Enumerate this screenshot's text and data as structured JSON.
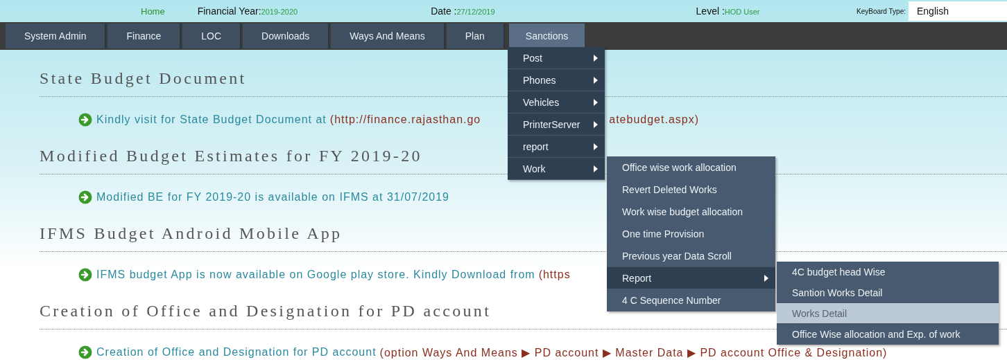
{
  "header": {
    "home": "Home",
    "financial_year_label": "Financial Year:",
    "financial_year": "2019-2020",
    "date_label": "Date :",
    "date": "27/12/2019",
    "level_label": "Level :",
    "level": "HOD User",
    "keyboard_label": "KeyBoard Type:",
    "keyboard_value": "English"
  },
  "nav": [
    {
      "label": "System Admin",
      "selected": false
    },
    {
      "label": "Finance",
      "selected": false
    },
    {
      "label": "LOC",
      "selected": false
    },
    {
      "label": "Downloads",
      "selected": false
    },
    {
      "label": "Ways And Means",
      "selected": false
    },
    {
      "label": "Plan",
      "selected": false
    },
    {
      "label": "Sanctions",
      "selected": true
    }
  ],
  "menus": [
    {
      "items": [
        {
          "label": "Post",
          "has_submenu": true
        },
        {
          "label": "Phones",
          "has_submenu": true
        },
        {
          "label": "Vehicles",
          "has_submenu": true
        },
        {
          "label": "PrinterServer",
          "has_submenu": true
        },
        {
          "label": "report",
          "has_submenu": true
        },
        {
          "label": "Work",
          "has_submenu": true
        }
      ]
    },
    {
      "items": [
        {
          "label": "Office wise work allocation",
          "has_submenu": false,
          "selected": false
        },
        {
          "label": "Revert Deleted Works",
          "has_submenu": false,
          "selected": false
        },
        {
          "label": "Work wise budget allocation",
          "has_submenu": false,
          "selected": false
        },
        {
          "label": "One time Provision",
          "has_submenu": false,
          "selected": false
        },
        {
          "label": "Previous year Data Scroll",
          "has_submenu": false,
          "selected": false
        },
        {
          "label": "Report",
          "has_submenu": true,
          "selected": true
        },
        {
          "label": "4 C Sequence Number",
          "has_submenu": false,
          "selected": false
        }
      ]
    },
    {
      "items": [
        {
          "label": "4C budget head Wise",
          "has_submenu": false,
          "selected": false
        },
        {
          "label": "Santion Works Detail",
          "has_submenu": false,
          "selected": false
        },
        {
          "label": "Works Detail",
          "has_submenu": false,
          "selected": true
        },
        {
          "label": "Office Wise allocation and Exp. of work",
          "has_submenu": false,
          "selected": false
        }
      ]
    }
  ],
  "sections": [
    {
      "title": "State Budget Document",
      "notice": {
        "text": "Kindly visit for State Budget Document at",
        "link_parts": [
          "(http://finance.rajasthan.go",
          "atebudget.aspx)"
        ]
      }
    },
    {
      "title": "Modified Budget Estimates for FY 2019-20",
      "notice": {
        "text": "Modified BE for FY 2019-20 is available on IFMS at 31/07/2019"
      }
    },
    {
      "title": "IFMS Budget Android Mobile App",
      "notice": {
        "text": "IFMS budget App is now available on Google play store. Kindly Download from",
        "link_parts": [
          "(https"
        ]
      }
    },
    {
      "title": "Creation of Office and Designation for PD account",
      "notice": {
        "text": "Creation of Office and Designation for PD account",
        "link_parts": [
          "(option Ways And Means ▶ PD account ▶ Master Data ▶ PD account Office & Designation)"
        ]
      }
    }
  ]
}
